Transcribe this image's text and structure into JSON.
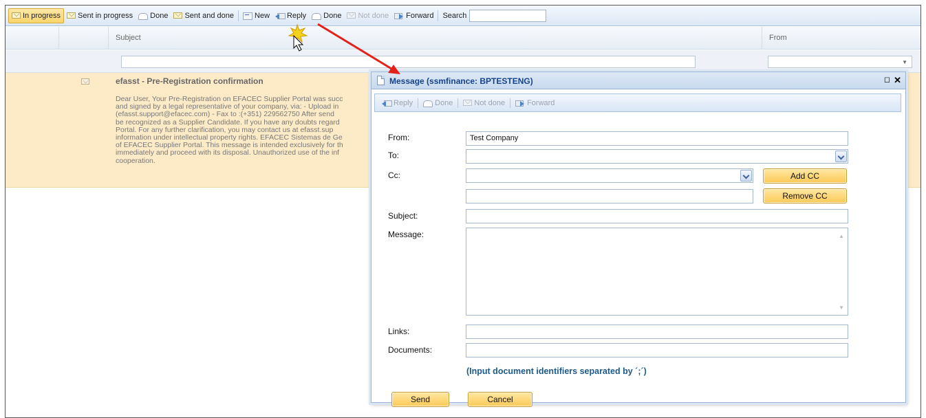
{
  "toolbar": {
    "in_progress": "In progress",
    "sent_in_progress": "Sent in progress",
    "done": "Done",
    "sent_and_done": "Sent and done",
    "new": "New",
    "reply": "Reply",
    "done2": "Done",
    "not_done": "Not done",
    "forward": "Forward",
    "search_label": "Search",
    "search_value": ""
  },
  "grid": {
    "col_subject": "Subject",
    "col_from": "From",
    "subject_filter": "",
    "from_filter": ""
  },
  "message_row": {
    "title": "efasst - Pre-Registration confirmation",
    "body_lines": [
      "Dear User, Your Pre-Registration on EFACEC Supplier Portal was succ",
      "and signed by a legal representative of your company, via: - Upload in",
      "(efasst.support@efacec.com) - Fax to :(+351) 229562750 After send",
      "be recognized as a Supplier Candidate. If you have any doubts regard",
      "Portal. For any further clarification, you may contact us at efasst.sup",
      "information under intellectual property rights. EFACEC Sistemas de Ge",
      "of EFACEC Supplier Portal. This message is intended exclusively for th",
      "immediately and proceed with its disposal. Unauthorized use of the inf",
      "cooperation."
    ]
  },
  "modal": {
    "title": "Message (ssmfinance: BPTESTENG)",
    "toolbar": {
      "reply": "Reply",
      "done": "Done",
      "not_done": "Not done",
      "forward": "Forward"
    },
    "labels": {
      "from": "From:",
      "to": "To:",
      "cc": "Cc:",
      "subject": "Subject:",
      "message": "Message:",
      "links": "Links:",
      "documents": "Documents:"
    },
    "values": {
      "from": "Test Company",
      "to": "",
      "cc": "",
      "cc_extra": "",
      "subject": "",
      "message": "",
      "links": "",
      "documents": ""
    },
    "add_cc": "Add CC",
    "remove_cc": "Remove CC",
    "hint": "(Input document identifiers separated by ´;´)",
    "send": "Send",
    "cancel": "Cancel"
  },
  "colors": {
    "accent_blue": "#15428b",
    "active_yellow": "#fbd56b",
    "row_highlight": "#fdebc8",
    "annotation_red": "#e3211b"
  }
}
